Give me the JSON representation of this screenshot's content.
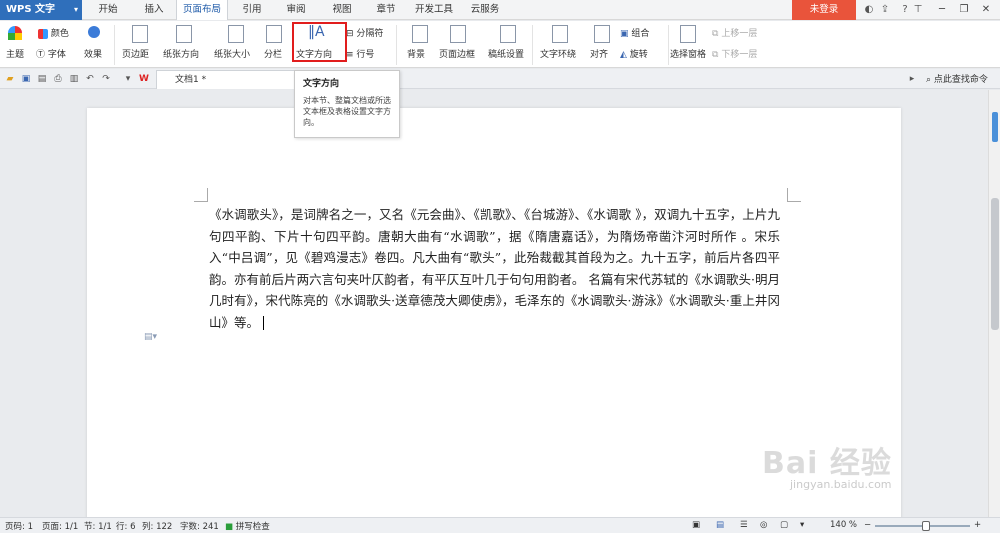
{
  "titlebar": {
    "app_name": "WPS 文字",
    "menu_tabs": [
      "开始",
      "插入",
      "页面布局",
      "引用",
      "审阅",
      "视图",
      "章节",
      "开发工具",
      "云服务"
    ],
    "active_tab": "页面布局",
    "login": "未登录"
  },
  "ribbon": {
    "theme": "主题",
    "color": "颜色",
    "font": "字体",
    "effect": "效果",
    "margin": "页边距",
    "orientation": "纸张方向",
    "size": "纸张大小",
    "columns": "分栏",
    "text_direction": "文字方向",
    "separator": "分隔符",
    "line_number": "行号",
    "background": "背景",
    "page_border": "页面边框",
    "manuscript": "稿纸设置",
    "text_wrap": "文字环绕",
    "align": "对齐",
    "group": "组合",
    "rotate": "旋转",
    "selection_pane": "选择窗格",
    "bring_forward": "上移一层",
    "send_backward": "下移一层"
  },
  "tooltip": {
    "title": "文字方向",
    "body": "对本节、整篇文档或所选文本框及表格设置文字方向。"
  },
  "tabs": {
    "doc_name": "文档1 *",
    "search_cmd": "点此查找命令"
  },
  "document": {
    "text": "《水调歌头》，是词牌名之一，又名《元会曲》、《凯歌》、《台城游》、《水调歌 》，双调九十五字，上片九句四平韵、下片十句四平韵。唐朝大曲有“水调歌”，据《隋唐嘉话》，为隋炀帝凿汴河时所作 。宋乐入“中吕调”，见《碧鸡漫志》卷四。凡大曲有“歌头”，此殆裁截其首段为之。九十五字，前后片各四平韵。亦有前后片两六言句夹叶仄韵者，有平仄互叶几于句句用韵者。 名篇有宋代苏轼的《水调歌头·明月几时有》，宋代陈亮的《水调歌头·送章德茂大卿使虏》，毛泽东的《水调歌头·游泳》《水调歌头·重上井冈山》等。"
  },
  "statusbar": {
    "page_code": "页码: 1",
    "page": "页面: 1/1",
    "section": "节: 1/1",
    "row": "行: 6",
    "col": "列: 122",
    "words": "字数: 241",
    "spellcheck": "拼写检查",
    "zoom": "140 %"
  },
  "watermark": {
    "text": "Bai 经验",
    "sub": "jingyan.baidu.com"
  }
}
